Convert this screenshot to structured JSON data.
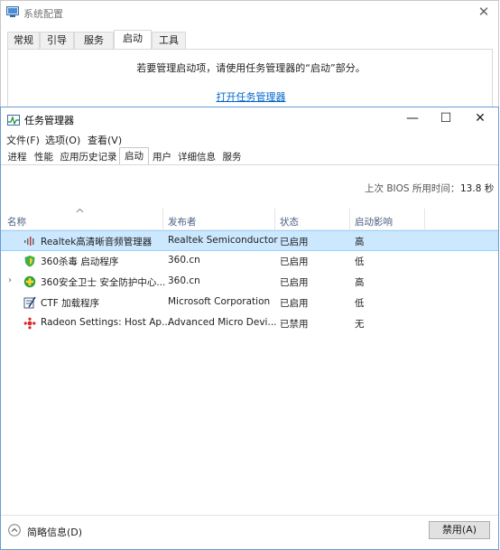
{
  "msconfig": {
    "title": "系统配置",
    "close": "✕",
    "tabs": [
      "常规",
      "引导",
      "服务",
      "启动",
      "工具"
    ],
    "hint": "若要管理启动项，请使用任务管理器的“启动”部分。",
    "link": "打开任务管理器"
  },
  "taskmgr": {
    "title": "任务管理器",
    "minimize": "—",
    "maximize": "☐",
    "close": "✕",
    "menu": [
      "文件(F)",
      "选项(O)",
      "查看(V)"
    ],
    "tabs": [
      "进程",
      "性能",
      "应用历史记录",
      "启动",
      "用户",
      "详细信息",
      "服务"
    ],
    "bios_label": "上次 BIOS 所用时间：",
    "bios_value": "13.8 秒",
    "columns": [
      "名称",
      "发布者",
      "状态",
      "启动影响"
    ],
    "rows": [
      {
        "name": "Realtek高清晰音频管理器",
        "publisher": "Realtek Semiconductor",
        "status": "已启用",
        "impact": "高",
        "icon": "realtek-audio-icon"
      },
      {
        "name": "360杀毒 启动程序",
        "publisher": "360.cn",
        "status": "已启用",
        "impact": "低",
        "icon": "360-antivirus-icon"
      },
      {
        "name": "360安全卫士 安全防护中心...",
        "publisher": "360.cn",
        "status": "已启用",
        "impact": "高",
        "icon": "360-safe-icon"
      },
      {
        "name": "CTF 加载程序",
        "publisher": "Microsoft Corporation",
        "status": "已启用",
        "impact": "低",
        "icon": "ctf-loader-icon"
      },
      {
        "name": "Radeon Settings: Host Ap...",
        "publisher": "Advanced Micro Devi...",
        "status": "已禁用",
        "impact": "无",
        "icon": "radeon-icon"
      }
    ],
    "fewer_details": "简略信息(D)",
    "disable_button": "禁用(A)",
    "expand_glyph": "›"
  },
  "colors": {
    "selection": "#cce8ff",
    "link": "#0066cc",
    "header_text": "#4d6082"
  }
}
